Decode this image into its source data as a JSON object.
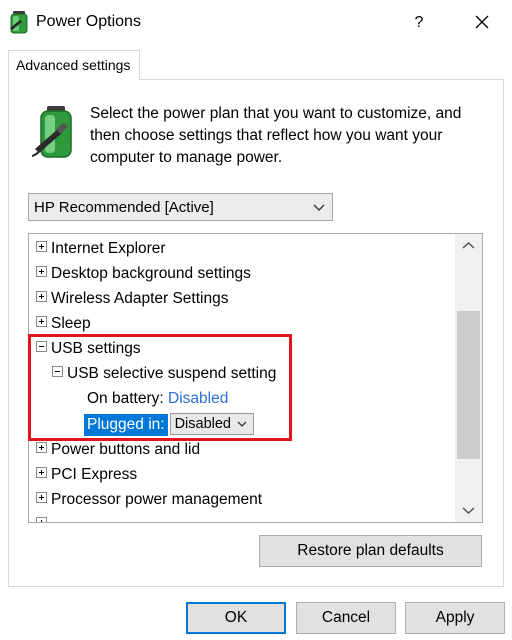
{
  "window": {
    "title": "Power Options",
    "help": "?"
  },
  "tab": {
    "label": "Advanced settings"
  },
  "intro": {
    "text": "Select the power plan that you want to customize, and then choose settings that reflect how you want your computer to manage power."
  },
  "plan": {
    "selected": "HP Recommended [Active]"
  },
  "tree": {
    "items": [
      {
        "label": "Internet Explorer"
      },
      {
        "label": "Desktop background settings"
      },
      {
        "label": "Wireless Adapter Settings"
      },
      {
        "label": "Sleep"
      },
      {
        "label": "USB settings"
      },
      {
        "label": "USB selective suspend setting"
      },
      {
        "label": "Power buttons and lid"
      },
      {
        "label": "PCI Express"
      },
      {
        "label": "Processor power management"
      }
    ],
    "on_battery": {
      "label": "On battery:",
      "value": "Disabled"
    },
    "plugged_in": {
      "label": "Plugged in:",
      "value": "Disabled"
    }
  },
  "buttons": {
    "restore": "Restore plan defaults",
    "ok": "OK",
    "cancel": "Cancel",
    "apply": "Apply"
  },
  "colors": {
    "accent": "#0078d7",
    "link": "#2a6fd6",
    "highlight": "#e0141e"
  }
}
